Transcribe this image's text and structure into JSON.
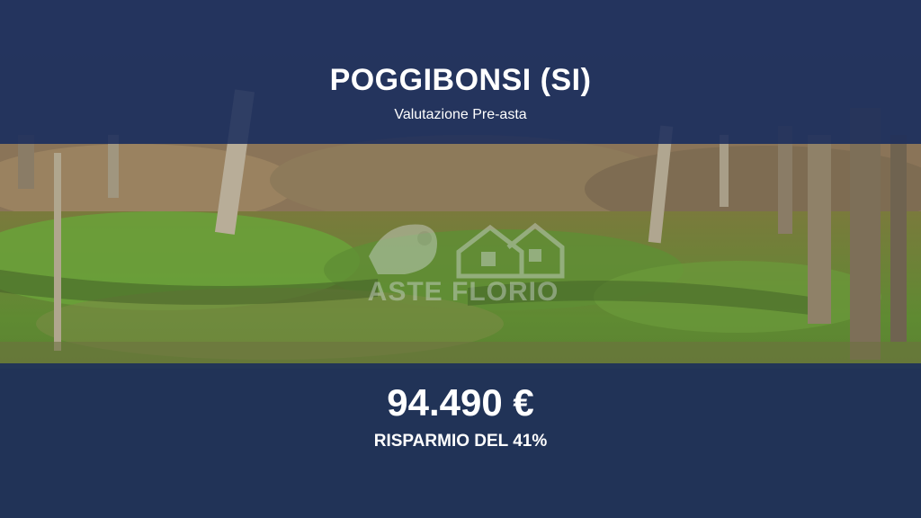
{
  "listing": {
    "location": "POGGIBONSI (SI)",
    "subtitle": "Valutazione Pre-asta",
    "price": "94.490 €",
    "savings": "RISPARMIO DEL 41%"
  },
  "watermark": {
    "text": "ASTE FLORIO"
  },
  "colors": {
    "band": "#182b5c",
    "text": "#ffffff"
  }
}
